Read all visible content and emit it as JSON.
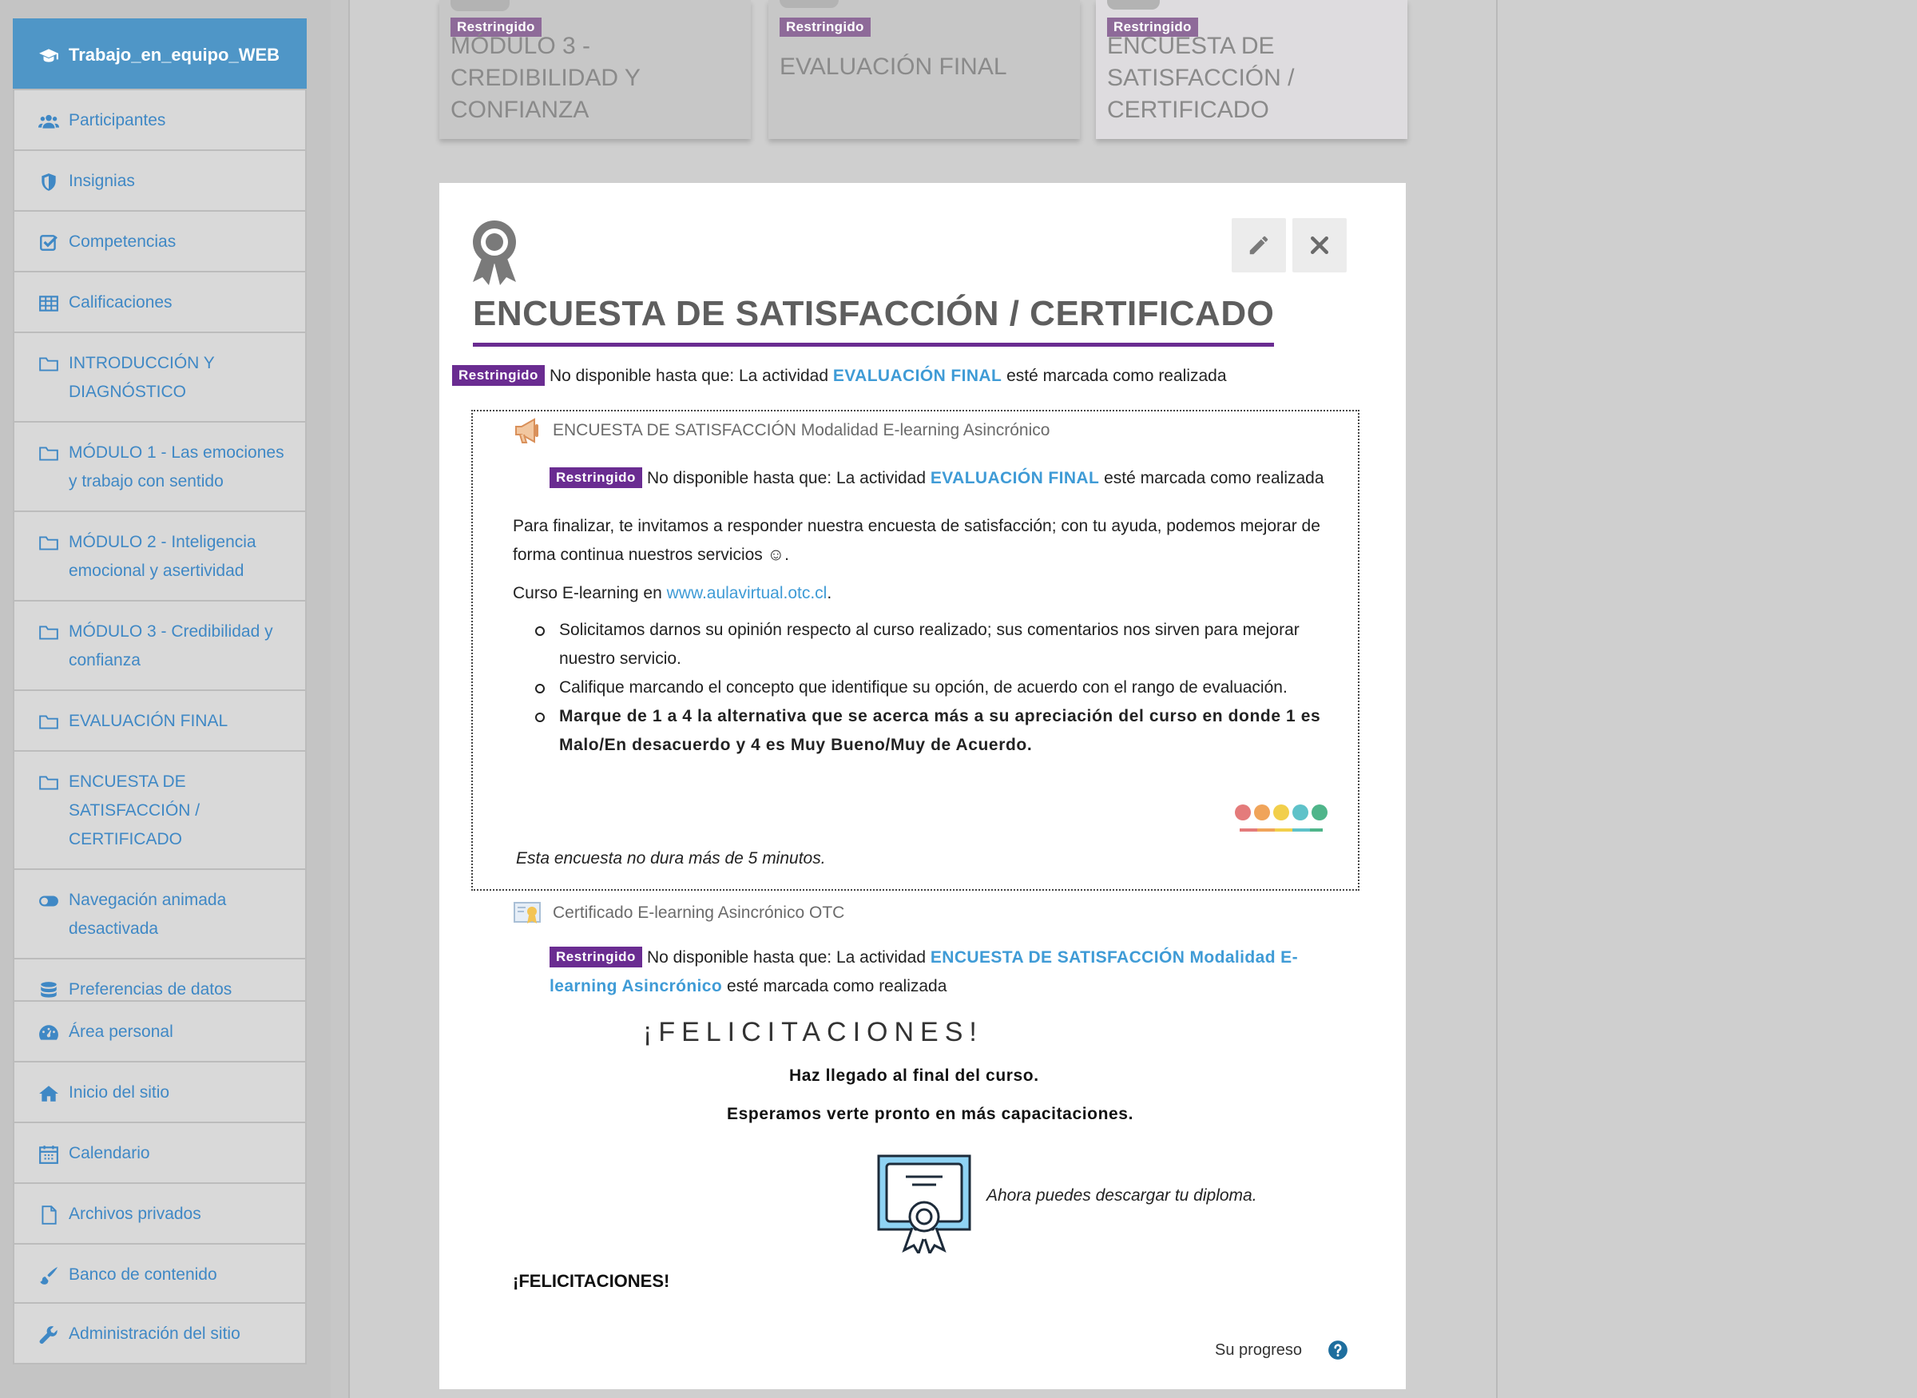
{
  "sidebar": {
    "course": "Trabajo_en_equipo_WEB",
    "items": [
      {
        "label": "Participantes",
        "icon": "users-icon"
      },
      {
        "label": "Insignias",
        "icon": "shield-icon"
      },
      {
        "label": "Competencias",
        "icon": "checkbox-icon"
      },
      {
        "label": "Calificaciones",
        "icon": "table-icon"
      },
      {
        "label": "INTRODUCCIÓN Y DIAGNÓSTICO",
        "icon": "folder-icon"
      },
      {
        "label": "MÓDULO 1 - Las emociones y trabajo con sentido",
        "icon": "folder-icon"
      },
      {
        "label": "MÓDULO 2 - Inteligencia emocional y asertividad",
        "icon": "folder-icon"
      },
      {
        "label": "MÓDULO 3 - Credibilidad y confianza",
        "icon": "folder-icon"
      },
      {
        "label": "EVALUACIÓN FINAL",
        "icon": "folder-icon"
      },
      {
        "label": "ENCUESTA DE SATISFACCIÓN / CERTIFICADO",
        "icon": "folder-icon"
      },
      {
        "label": "Navegación animada desactivada",
        "icon": "toggle-icon"
      },
      {
        "label": "Preferencias de datos",
        "icon": "database-icon"
      }
    ],
    "global": [
      {
        "label": "Área personal",
        "icon": "dashboard-icon"
      },
      {
        "label": "Inicio del sitio",
        "icon": "home-icon"
      },
      {
        "label": "Calendario",
        "icon": "calendar-icon"
      },
      {
        "label": "Archivos privados",
        "icon": "file-icon"
      },
      {
        "label": "Banco de contenido",
        "icon": "brush-icon"
      }
    ],
    "admin": {
      "label": "Administración del sitio",
      "icon": "wrench-icon"
    }
  },
  "tiles": [
    {
      "badge": "Restringido",
      "title": "MÓDULO 3 - CREDIBILIDAD Y CONFIANZA"
    },
    {
      "badge": "Restringido",
      "title": "EVALUACIÓN FINAL"
    },
    {
      "badge": "Restringido",
      "title": "ENCUESTA DE SATISFACCIÓN / CERTIFICADO"
    }
  ],
  "section": {
    "title": "ENCUESTA DE SATISFACCIÓN / CERTIFICADO",
    "restriction": {
      "badge": "Restringido",
      "prefix": "No disponible hasta que: La actividad",
      "activity": "EVALUACIÓN FINAL",
      "suffix": "esté marcada como realizada"
    }
  },
  "survey": {
    "title": "ENCUESTA DE SATISFACCIÓN Modalidad E-learning Asincrónico",
    "restriction": {
      "badge": "Restringido",
      "prefix": "No disponible hasta que: La actividad",
      "activity": "EVALUACIÓN FINAL",
      "suffix": "esté marcada como realizada"
    },
    "intro_line1": "Para finalizar, te invitamos a responder nuestra encuesta de satisfacción; con tu ayuda, podemos mejorar de",
    "intro_line2": "forma continua nuestros servicios ☺.",
    "course_prefix": "Curso E-learning en",
    "course_link": "www.aulavirtual.otc.cl",
    "course_suffix": ".",
    "bullets": [
      "Solicitamos darnos su opinión respecto al curso realizado; sus comentarios nos sirven para mejorar nuestro servicio.",
      "Califique marcando el concepto que identifique su opción, de acuerdo con el rango de evaluación.",
      "Marque de 1 a 4 la alternativa que se acerca más a su apreciación del curso en donde 1 es Malo/En desacuerdo y 4 es Muy Bueno/Muy de Acuerdo."
    ],
    "note": "Esta encuesta no dura más de 5 minutos."
  },
  "certificate": {
    "title": "Certificado E-learning Asincrónico OTC",
    "restriction": {
      "badge": "Restringido",
      "prefix": "No disponible hasta que: La actividad",
      "activity": "ENCUESTA DE SATISFACCIÓN Modalidad E-learning Asincrónico",
      "suffix": "esté marcada como realizada"
    },
    "congrats_spaced": "¡FELICITACIONES!",
    "reached_end": "Haz llegado al final del curso.",
    "see_you": "Esperamos verte pronto en más capacitaciones.",
    "download": "Ahora puedes descargar tu diploma.",
    "congrats_final": "¡FELICITACIONES!"
  },
  "progress": {
    "label": "Su progreso"
  },
  "colors": {
    "primary": "#4f96c7",
    "link": "#3f9bd6",
    "restricted": "#6a2c91",
    "muted_badge": "#8e6a99"
  }
}
